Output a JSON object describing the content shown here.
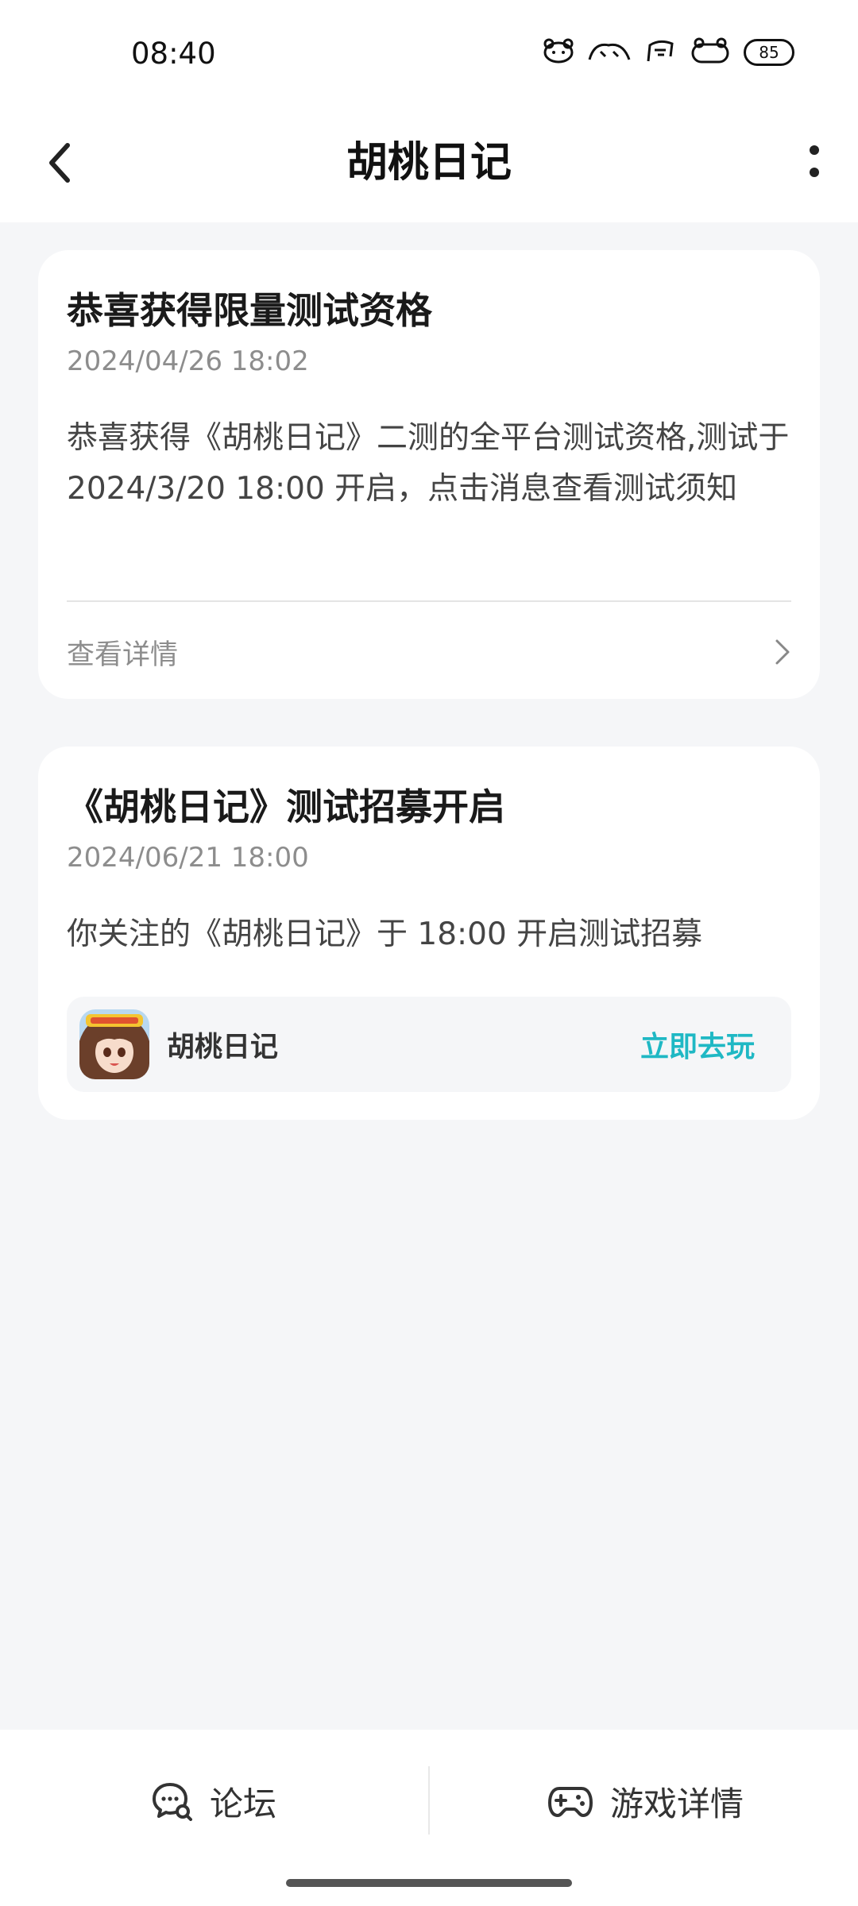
{
  "status_bar": {
    "time": "08:40",
    "icons": [
      "app-icon-1",
      "app-icon-2",
      "app-icon-3",
      "app-icon-4"
    ],
    "battery": "85"
  },
  "nav": {
    "title": "胡桃日记"
  },
  "messages": [
    {
      "title": "恭喜获得限量测试资格",
      "time": "2024/04/26 18:02",
      "body": "恭喜获得《胡桃日记》二测的全平台测试资格,测试于 2024/3/20 18:00 开启，点击消息查看测试须知",
      "detail_label": "查看详情"
    },
    {
      "title": "《胡桃日记》测试招募开启",
      "time": "2024/06/21 18:00",
      "body": "你关注的《胡桃日记》于 18:00 开启测试招募",
      "game": {
        "name": "胡桃日记",
        "action": "立即去玩"
      }
    }
  ],
  "bottom_bar": {
    "forum_label": "论坛",
    "game_detail_label": "游戏详情"
  },
  "colors": {
    "accent": "#1fb8c4",
    "background": "#f5f6f8"
  }
}
